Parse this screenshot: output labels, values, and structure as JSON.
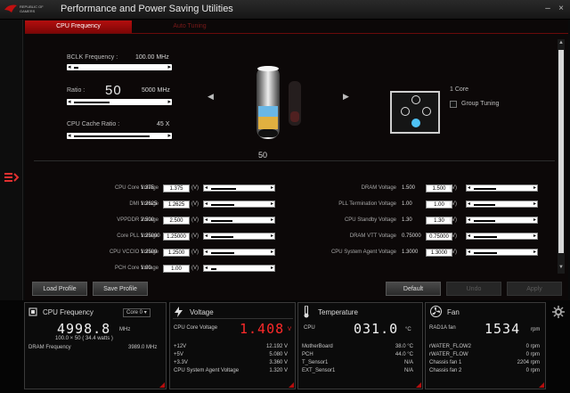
{
  "window": {
    "brand_line1": "REPUBLIC OF",
    "brand_line2": "GAMERS",
    "title": "Performance and Power Saving Utilities",
    "controls": [
      "–",
      "×"
    ]
  },
  "tabs": [
    {
      "label": "CPU Frequency",
      "active": true
    },
    {
      "label": "Auto Tuning",
      "active": false
    }
  ],
  "cpu_freq": {
    "bclk_label": "BCLK Frequency :",
    "bclk_value": "100.00 MHz",
    "bclk_level": 0.05,
    "ratio_label": "Ratio :",
    "ratio_big": "50",
    "ratio_value": "5000 MHz",
    "ratio_level": 0.4,
    "cache_label": "CPU Cache Ratio :",
    "cache_value": "45 X",
    "cache_level": 0.85,
    "gauge_label": "50",
    "core_label": "1 Core",
    "group_tuning_label": "Group Tuning"
  },
  "voltages_left": [
    {
      "label": "CPU Core Voltage",
      "value": "1.375",
      "box": "1.375",
      "unit": "(V)",
      "level": 0.45
    },
    {
      "label": "DMI Voltage",
      "value": "1.2625",
      "box": "1.2625",
      "unit": "(V)",
      "level": 0.42
    },
    {
      "label": "VPPDDR Voltage",
      "value": "2.500",
      "box": "2.500",
      "unit": "(V)",
      "level": 0.38
    },
    {
      "label": "Core PLL Voltage",
      "value": "1.25000",
      "box": "1.25000",
      "unit": "(V)",
      "level": 0.4
    },
    {
      "label": "CPU VCCIO Voltage",
      "value": "1.2500",
      "box": "1.2500",
      "unit": "(V)",
      "level": 0.42
    },
    {
      "label": "PCH Core Voltage",
      "value": "1.00",
      "box": "1.00",
      "unit": "(V)",
      "level": 0.1
    }
  ],
  "voltages_right": [
    {
      "label": "DRAM Voltage",
      "value": "1.500",
      "box": "1.500",
      "unit": "(V)",
      "level": 0.4
    },
    {
      "label": "PLL Termination Voltage",
      "value": "1.00",
      "box": "1.00",
      "unit": "(V)",
      "level": 0.38
    },
    {
      "label": "CPU Standby Voltage",
      "value": "1.30",
      "box": "1.30",
      "unit": "(V)",
      "level": 0.38
    },
    {
      "label": "DRAM VTT Voltage",
      "value": "0.75000",
      "box": "0.75000",
      "unit": "(V)",
      "level": 0.42
    },
    {
      "label": "CPU System Agent Voltage",
      "value": "1.3000",
      "box": "1.3000",
      "unit": "(V)",
      "level": 0.42
    }
  ],
  "buttons": {
    "load_profile": "Load Profile",
    "save_profile": "Save Profile",
    "default": "Default",
    "undo": "Undo",
    "apply": "Apply"
  },
  "monitor": {
    "cpu": {
      "title": "CPU Frequency",
      "core_select": "Core 0",
      "freq": "4998.8",
      "freq_unit": "MHz",
      "ratio_line": "100.0  × 50   ( 34.4 watts )",
      "dram_label": "DRAM Frequency",
      "dram_value": "3989.0  MHz"
    },
    "voltage": {
      "title": "Voltage",
      "main_label": "CPU Core Voltage",
      "main_value": "1.408",
      "main_unit": "V",
      "rows": [
        {
          "label": "+12V",
          "value": "12.192  V"
        },
        {
          "label": "+5V",
          "value": "5.080  V"
        },
        {
          "label": "+3.3V",
          "value": "3.360  V"
        },
        {
          "label": "CPU System Agent Voltage",
          "value": "1.320  V"
        }
      ]
    },
    "temperature": {
      "title": "Temperature",
      "main_label": "CPU",
      "main_value": "031.0",
      "main_unit": "°C",
      "rows": [
        {
          "label": "MotherBoard",
          "value": "38.0 °C"
        },
        {
          "label": "PCH",
          "value": "44.0 °C"
        },
        {
          "label": "T_Sensor1",
          "value": "N/A"
        },
        {
          "label": "EXT_Sensor1",
          "value": "N/A"
        }
      ]
    },
    "fan": {
      "title": "Fan",
      "main_label": "RAD1A fan",
      "main_value": "1534",
      "main_unit": "rpm",
      "rows": [
        {
          "label": "rWATER_FLOW2",
          "value": "0  rpm"
        },
        {
          "label": "rWATER_FLOW",
          "value": "0  rpm"
        },
        {
          "label": "Chassis fan 1",
          "value": "2204  rpm"
        },
        {
          "label": "Chassis fan 2",
          "value": "0  rpm"
        }
      ]
    }
  },
  "colors": {
    "accent": "#b30e0e",
    "voltage_value": "#ff2a2a"
  }
}
